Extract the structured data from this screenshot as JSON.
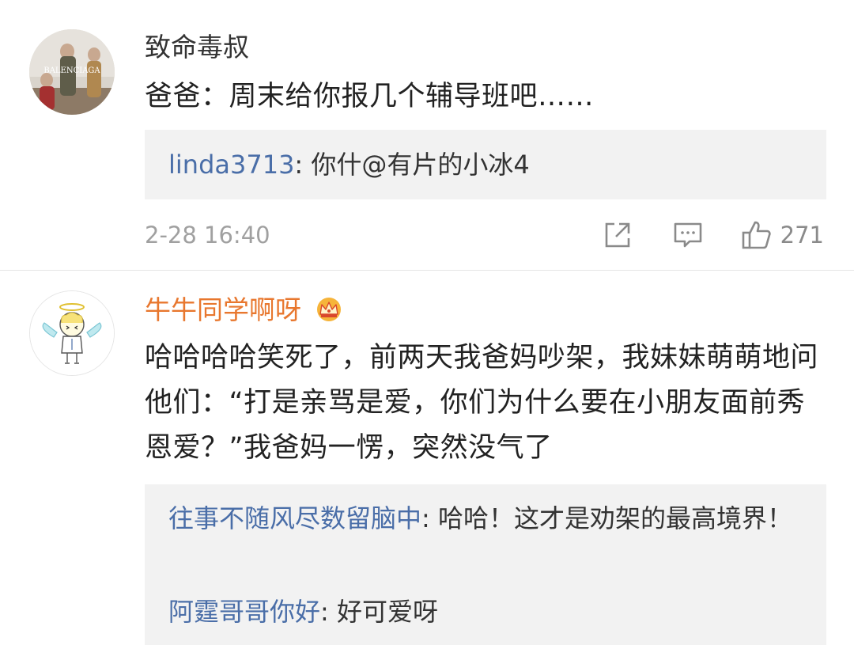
{
  "comments": [
    {
      "username": "致命毒叔",
      "avatar_text": "BALENCIAGA",
      "text": "爸爸：周末给你报几个辅导班吧……",
      "replies": [
        {
          "user": "linda3713",
          "text": ": 你什@有片的小冰4"
        }
      ],
      "timestamp": "2-28 16:40",
      "like_count": "271",
      "actions": [
        "share-icon",
        "comment-icon",
        "like-icon"
      ]
    },
    {
      "username": "牛牛同学啊呀",
      "username_color": "#e8772e",
      "badge": "crown-badge-icon",
      "text": "哈哈哈哈笑死了，前两天我爸妈吵架，我妹妹萌萌地问他们：“打是亲骂是爱，你们为什么要在小朋友面前秀恩爱？”我爸妈一愣，突然没气了",
      "replies": [
        {
          "user": "往事不随风尽数留脑中",
          "text": ": 哈哈！这才是劝架的最高境界！"
        },
        {
          "user": "阿霆哥哥你好",
          "text": ": 好可爱呀"
        }
      ]
    }
  ],
  "colors": {
    "link": "#4a6ea8",
    "vip_name": "#e8772e",
    "meta": "#a0a0a0",
    "reply_bg": "#f2f2f2"
  }
}
